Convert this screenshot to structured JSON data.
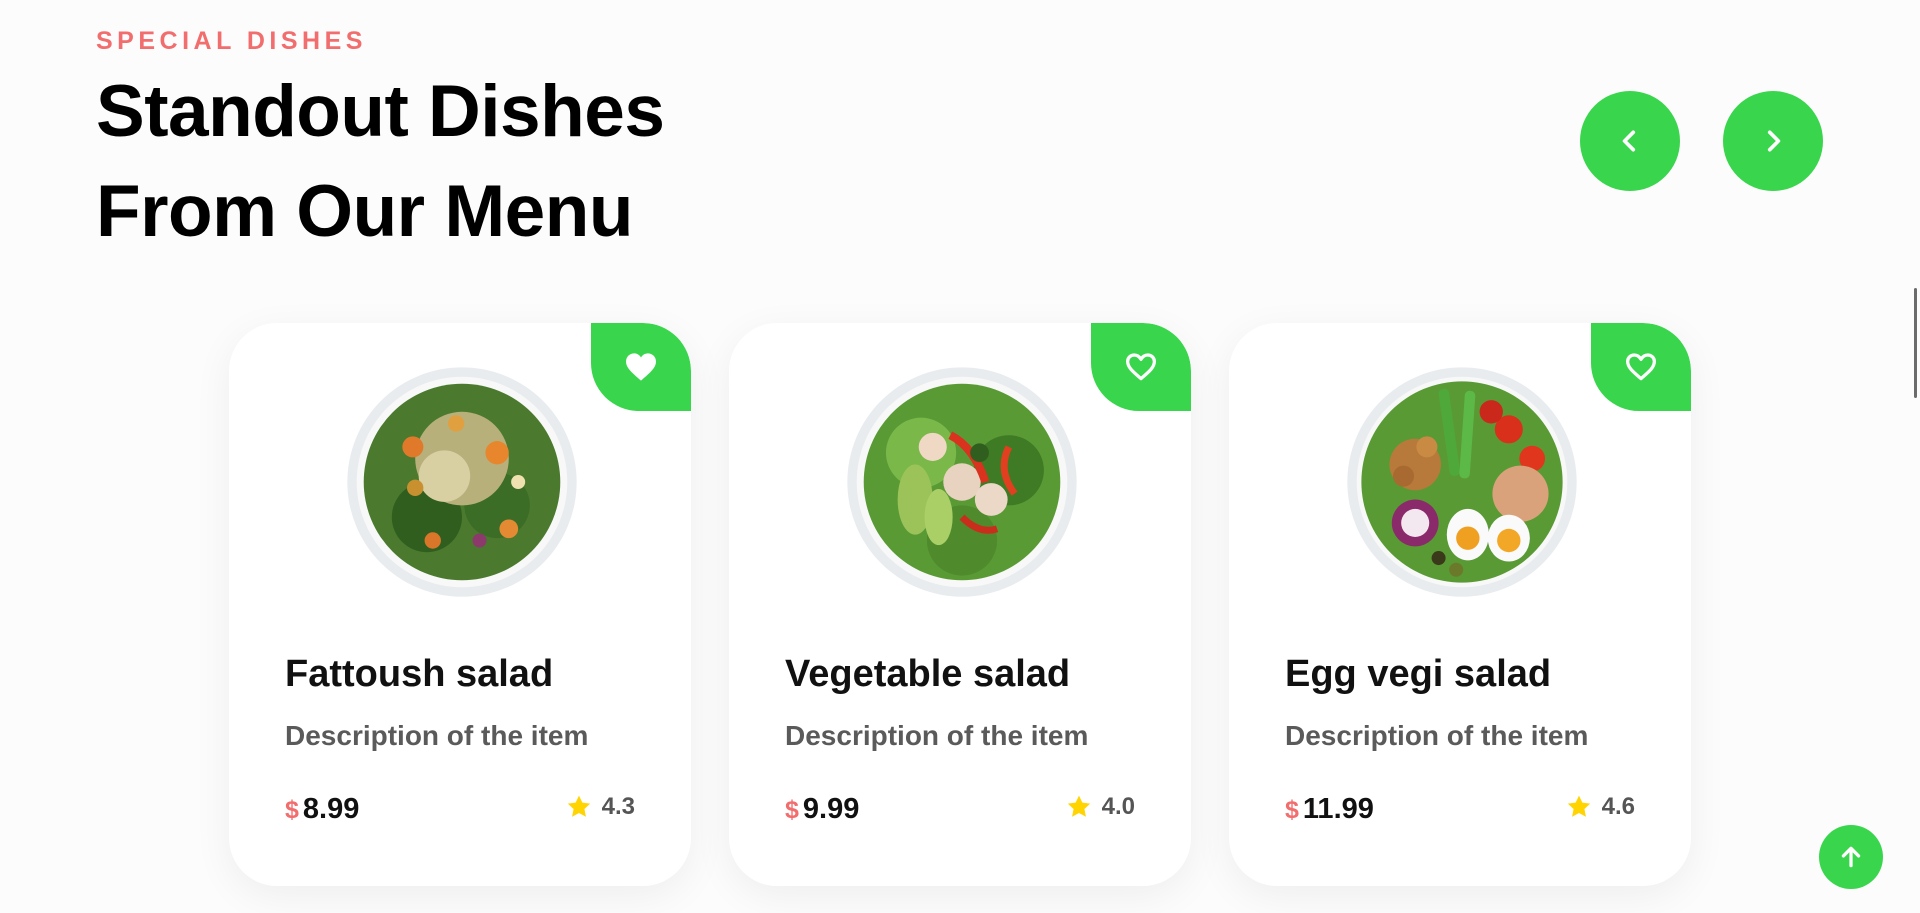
{
  "section": {
    "eyebrow": "SPECIAL DISHES",
    "title_line1": "Standout Dishes",
    "title_line2": "From Our Menu"
  },
  "colors": {
    "accent_green": "#39d64d",
    "accent_red": "#f26d6d",
    "star_yellow": "#ffd400"
  },
  "icons": {
    "prev": "chevron-left-icon",
    "next": "chevron-right-icon",
    "favorite": "heart-icon",
    "rating": "star-icon",
    "scroll_top": "arrow-up-icon"
  },
  "cards": [
    {
      "name": "Fattoush salad",
      "description": "Description of the item",
      "currency": "$",
      "price": "8.99",
      "rating": "4.3",
      "favorited": true
    },
    {
      "name": "Vegetable salad",
      "description": "Description of the item",
      "currency": "$",
      "price": "9.99",
      "rating": "4.0",
      "favorited": false
    },
    {
      "name": "Egg vegi salad",
      "description": "Description of the item",
      "currency": "$",
      "price": "11.99",
      "rating": "4.6",
      "favorited": false
    }
  ]
}
